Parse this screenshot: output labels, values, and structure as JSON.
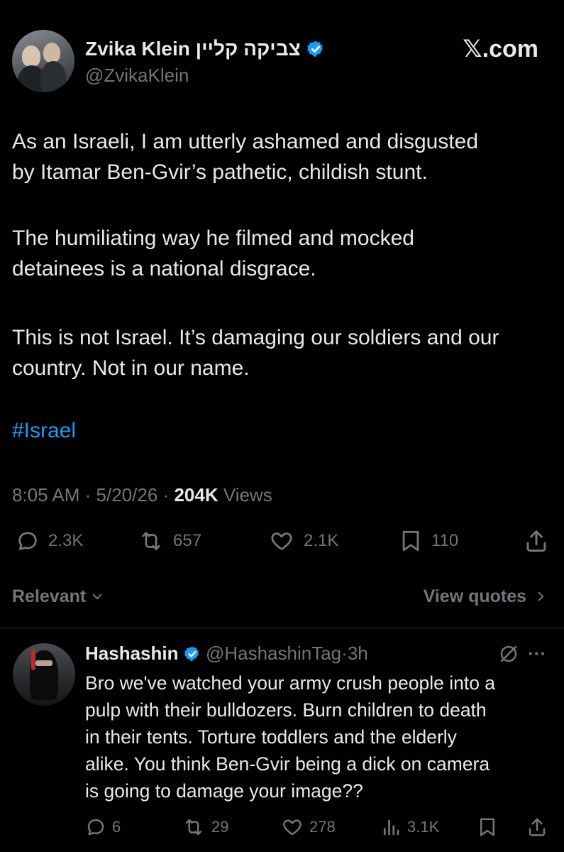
{
  "header": {
    "author_name": "Zvika Klein צביקה קליין",
    "author_handle": "@ZvikaKlein",
    "brand": "𝕏.com",
    "verified_color": "#1d9bf0"
  },
  "tweet": {
    "paragraphs": [
      "As an Israeli, I am utterly ashamed and disgusted\nby Itamar Ben-Gvir’s pathetic, childish stunt.",
      "The humiliating way he filmed and mocked\ndetainees is a national disgrace.",
      "This is not Israel. It’s damaging our soldiers and our\ncountry. Not in our name."
    ],
    "hashtag": "#Israel",
    "meta": {
      "time": "8:05 AM",
      "sep1": "·",
      "date": "5/20/26",
      "sep2": "·",
      "views_count": "204K",
      "views_label": "Views"
    },
    "actions": {
      "replies": "2.3K",
      "reposts": "657",
      "likes": "2.1K",
      "bookmarks": "110"
    }
  },
  "filters": {
    "relevant_label": "Relevant",
    "view_quotes_label": "View quotes"
  },
  "reply": {
    "author_name": "Hashashin",
    "author_handle": "@HashashinTag",
    "sep": "·",
    "age": "3h",
    "more": "···",
    "text": "Bro we've watched your army crush people into a\npulp with their bulldozers. Burn children to death\nin their tents. Torture toddlers and the elderly\nalike. You think Ben-Gvir being a dick on camera\nis going to damage your image??",
    "actions": {
      "replies": "6",
      "reposts": "29",
      "likes": "278",
      "views": "3.1K"
    }
  },
  "colors": {
    "background": "#000000",
    "text": "#e7e9ea",
    "muted": "#71767b",
    "accent": "#1d9bf0",
    "divider": "#2f3336"
  }
}
